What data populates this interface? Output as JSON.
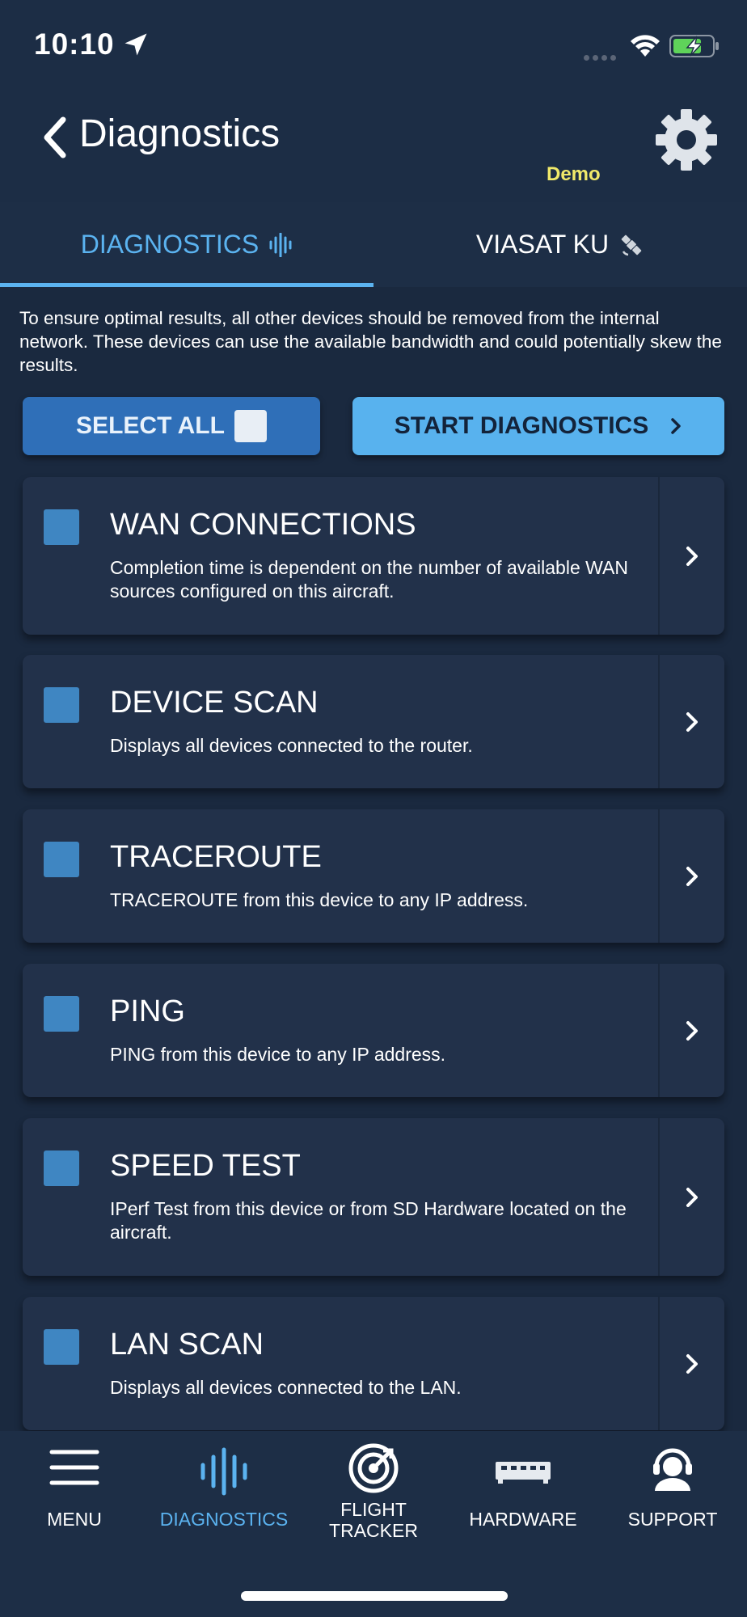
{
  "status_bar": {
    "time": "10:10"
  },
  "header": {
    "title": "Diagnostics",
    "badge": "Demo"
  },
  "tabs": [
    {
      "label": "DIAGNOSTICS",
      "active": true
    },
    {
      "label": "VIASAT KU",
      "active": false
    }
  ],
  "notice": "To ensure optimal results, all other devices should be removed from the  internal network. These devices can use the available bandwidth and could potentially skew the results.",
  "actions": {
    "select_all": "SELECT ALL",
    "start": "START DIAGNOSTICS"
  },
  "tests": [
    {
      "title": "WAN CONNECTIONS",
      "desc": "Completion time is dependent on the number of available WAN sources configured on this aircraft.",
      "checked": false
    },
    {
      "title": "DEVICE SCAN",
      "desc": "Displays all devices connected to the router.",
      "checked": false
    },
    {
      "title": "TRACEROUTE",
      "desc": "TRACEROUTE from this device to any IP address.",
      "checked": false
    },
    {
      "title": "PING",
      "desc": "PING from this device to any IP address.",
      "checked": false
    },
    {
      "title": "SPEED TEST",
      "desc": "IPerf Test from this device or from SD Hardware located on the aircraft.",
      "checked": false
    },
    {
      "title": "LAN SCAN",
      "desc": "Displays all devices connected to the LAN.",
      "checked": false
    }
  ],
  "nav": [
    {
      "label": "MENU",
      "icon": "hamburger-icon",
      "active": false
    },
    {
      "label": "DIAGNOSTICS",
      "icon": "waveform-icon",
      "active": true
    },
    {
      "label": "FLIGHT\nTRACKER",
      "icon": "flight-radar-icon",
      "active": false
    },
    {
      "label": "HARDWARE",
      "icon": "router-icon",
      "active": false
    },
    {
      "label": "SUPPORT",
      "icon": "headset-icon",
      "active": false
    }
  ],
  "colors": {
    "background": "#1c2d45",
    "accent": "#5bb3f0",
    "card": "#22314a",
    "badge": "#f0e96a",
    "checkbox": "#3f86c2"
  }
}
